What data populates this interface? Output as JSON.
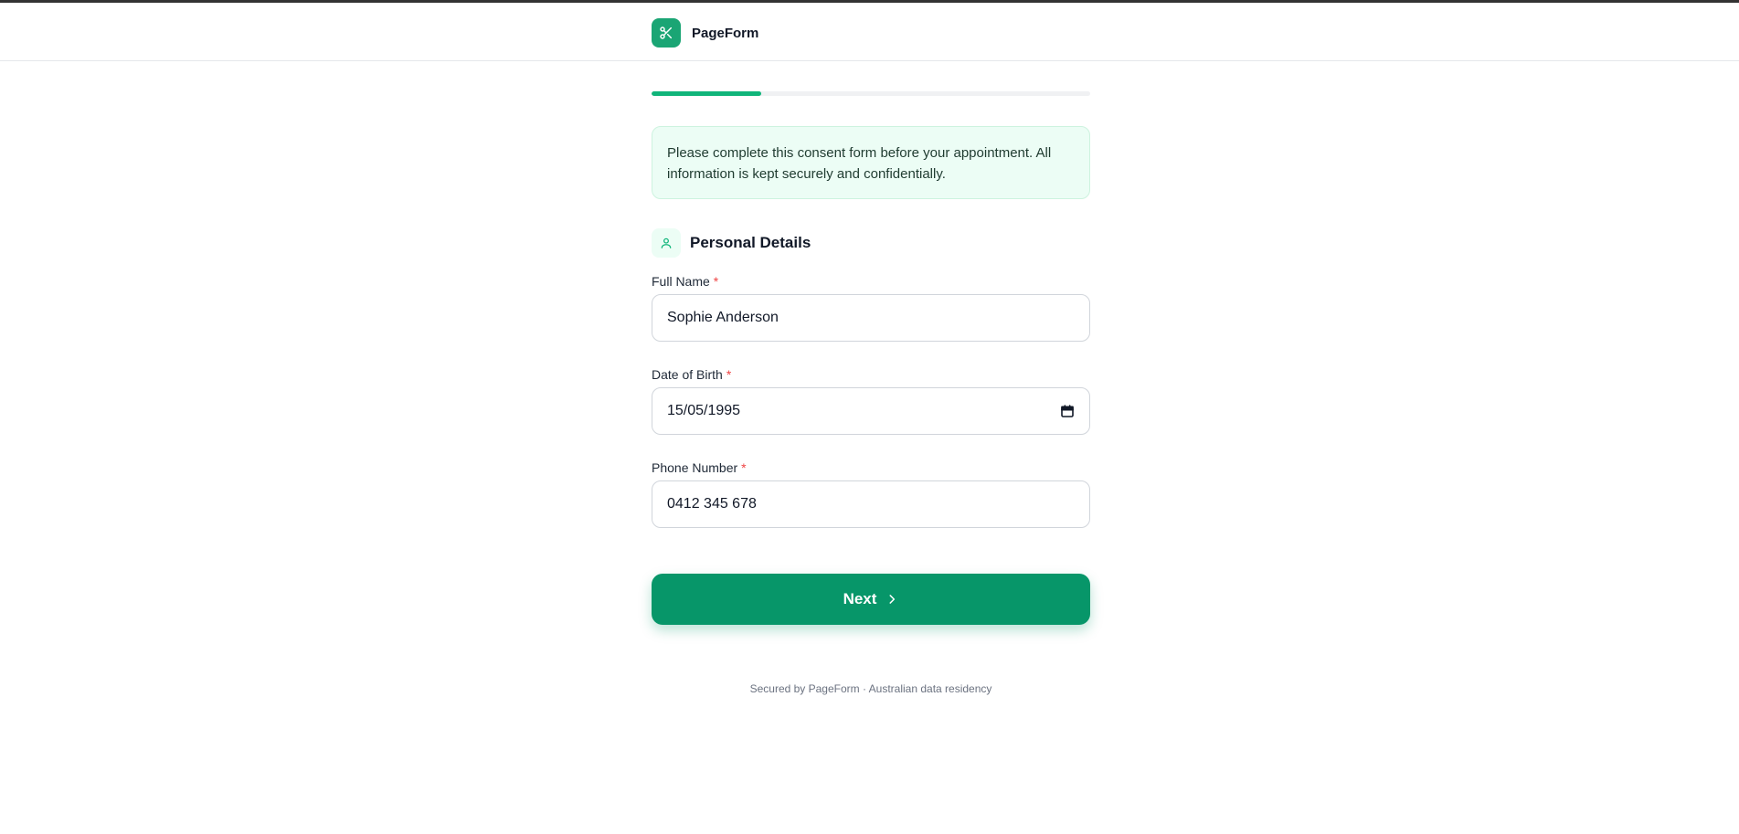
{
  "header": {
    "brand_name": "PageForm",
    "logo_icon": "scissors-icon",
    "accent_color": "#10b57a"
  },
  "progress": {
    "fraction": 0.25
  },
  "info": {
    "text": "Please complete this consent form before your appointment. All information is kept securely and confidentially."
  },
  "section": {
    "title": "Personal Details",
    "icon": "user-icon"
  },
  "fields": [
    {
      "label": "Full Name",
      "required_mark": "*",
      "value": "Sophie Anderson",
      "type": "text"
    },
    {
      "label": "Date of Birth",
      "required_mark": "*",
      "value": "15/05/1995",
      "type": "date",
      "icon": "calendar-icon"
    },
    {
      "label": "Phone Number",
      "required_mark": "*",
      "value": "0412 345 678",
      "type": "tel"
    }
  ],
  "actions": {
    "next_label": "Next",
    "next_icon": "chevron-right-icon",
    "button_color": "#079669"
  },
  "footer": {
    "text": "Secured by PageForm · Australian data residency"
  }
}
